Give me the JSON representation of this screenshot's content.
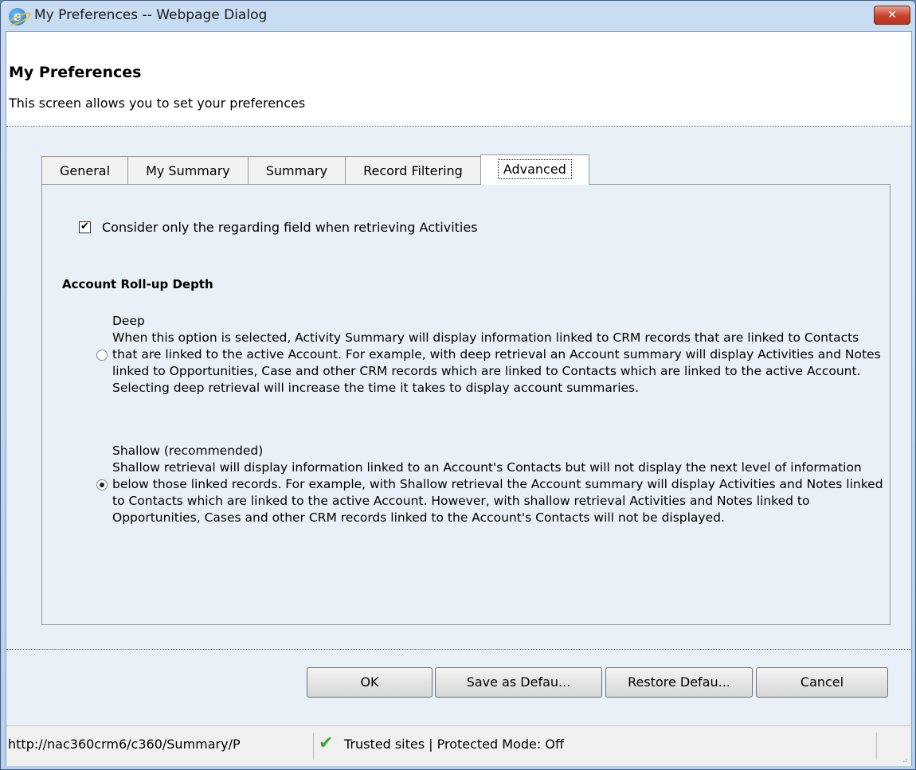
{
  "window": {
    "title": "My Preferences -- Webpage Dialog",
    "close_glyph": "✕",
    "icon": "ie-icon"
  },
  "header": {
    "title": "My Preferences",
    "subtitle": "This screen allows you to set your preferences"
  },
  "tabs": [
    {
      "label": "General",
      "active": false
    },
    {
      "label": "My Summary",
      "active": false
    },
    {
      "label": "Summary",
      "active": false
    },
    {
      "label": "Record Filtering",
      "active": false
    },
    {
      "label": "Advanced",
      "active": true
    }
  ],
  "advanced": {
    "checkbox": {
      "label": "Consider only the regarding field when retrieving Activities",
      "checked": true
    },
    "rollup": {
      "heading": "Account Roll-up Depth",
      "options": [
        {
          "title": "Deep",
          "selected": false,
          "description": "When this option is selected, Activity Summary will display information linked to CRM records that are linked to Contacts that are linked to the active Account. For example, with deep retrieval an Account summary will display Activities and Notes linked to Opportunities, Case and other CRM records which are linked to Contacts which are linked to the active Account. Selecting deep retrieval will increase the time it takes to display account summaries."
        },
        {
          "title": "Shallow (recommended)",
          "selected": true,
          "description": "Shallow retrieval will display information linked to an Account's Contacts but will not display the next level of information below those linked records. For example, with Shallow retrieval the Account summary will display Activities and Notes linked to Contacts which are linked to the active Account. However, with shallow retrieval Activities and Notes linked to Opportunities, Cases and other CRM records linked to the Account's Contacts will not be displayed."
        }
      ]
    }
  },
  "buttons": {
    "ok": "OK",
    "save_default": "Save as Defau...",
    "restore_default": "Restore Defau...",
    "cancel": "Cancel"
  },
  "statusbar": {
    "url": "http://nac360crm6/c360/Summary/P",
    "zone": "Trusted sites | Protected Mode: Off",
    "check_glyph": "✔",
    "grip_glyph": "⣠"
  }
}
